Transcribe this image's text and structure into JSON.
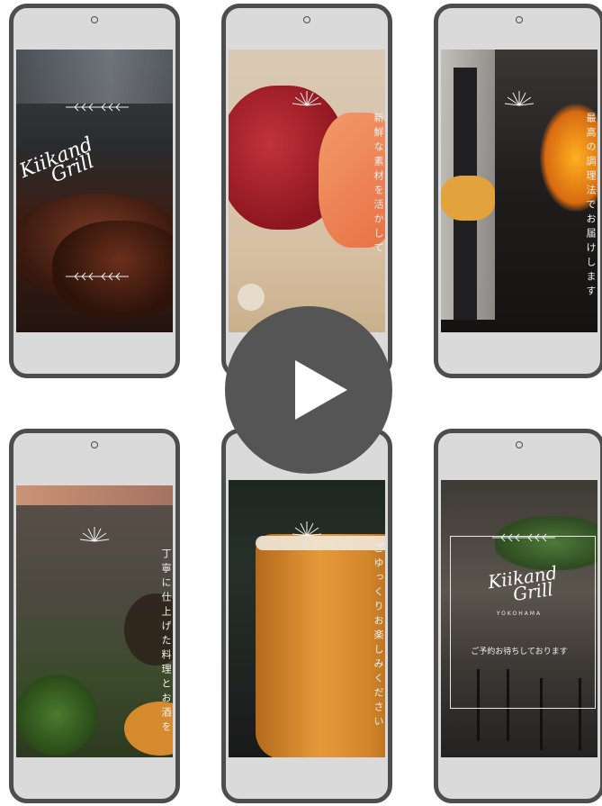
{
  "phones": [
    {
      "logo_line1": "Kiikand",
      "logo_line2": "Grill"
    },
    {
      "text": "新鮮な素材を活かして"
    },
    {
      "text": "最高の調理法でお届けします"
    },
    {
      "text": "丁寧に仕上げた料理とお酒を"
    },
    {
      "text": "ごゆっくりお楽しみください"
    },
    {
      "logo_line1": "Kiikand",
      "logo_line2": "Grill",
      "location": "YOKOHAMA",
      "tagline": "ご予約お待ちしております"
    }
  ],
  "play_button": {
    "icon": "play-icon"
  }
}
